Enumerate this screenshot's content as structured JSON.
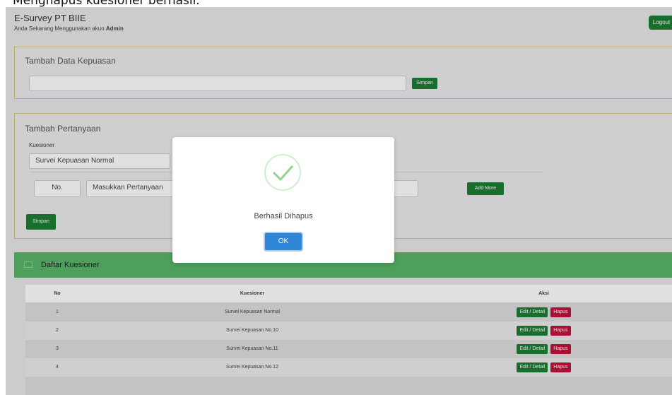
{
  "caption": "Menghapus kuesioner berhasil.",
  "header": {
    "title": "E-Survey PT BIIE",
    "subtitle_prefix": "Anda Sekarang Menggunakan akun",
    "subtitle_user": "Admin",
    "logout_label": "Logout"
  },
  "tambah_kepuasan": {
    "title": "Tambah Data Kepuasan",
    "input_value": "",
    "save_label": "Simpan"
  },
  "tambah_pertanyaan": {
    "title": "Tambah Pertanyaan",
    "kuesioner_label": "Kuesioner",
    "kuesioner_value": "Survei Kepuasan Normal",
    "no_placeholder": "No.",
    "pertanyaan_placeholder": "Masukkan Pertanyaan",
    "add_more_label": "Add More",
    "save_label": "Simpan"
  },
  "daftar": {
    "title": "Daftar Kuesioner",
    "columns": [
      "No",
      "Kuesioner",
      "Aksi"
    ],
    "edit_label": "Edit / Detail",
    "hapus_label": "Hapus",
    "rows": [
      {
        "no": "1",
        "name": "Survei Kepuasan Normal"
      },
      {
        "no": "2",
        "name": "Survei Kepuasan No.10"
      },
      {
        "no": "3",
        "name": "Survei Kepuasan No.11"
      },
      {
        "no": "4",
        "name": "Survei Kepuasan No.12"
      }
    ]
  },
  "dialog": {
    "message": "Berhasil Dihapus",
    "ok_label": "OK"
  },
  "colors": {
    "green": "#1e7e34",
    "red": "#c0143c",
    "list_header": "#59b469",
    "ok_blue": "#2f86d6"
  }
}
